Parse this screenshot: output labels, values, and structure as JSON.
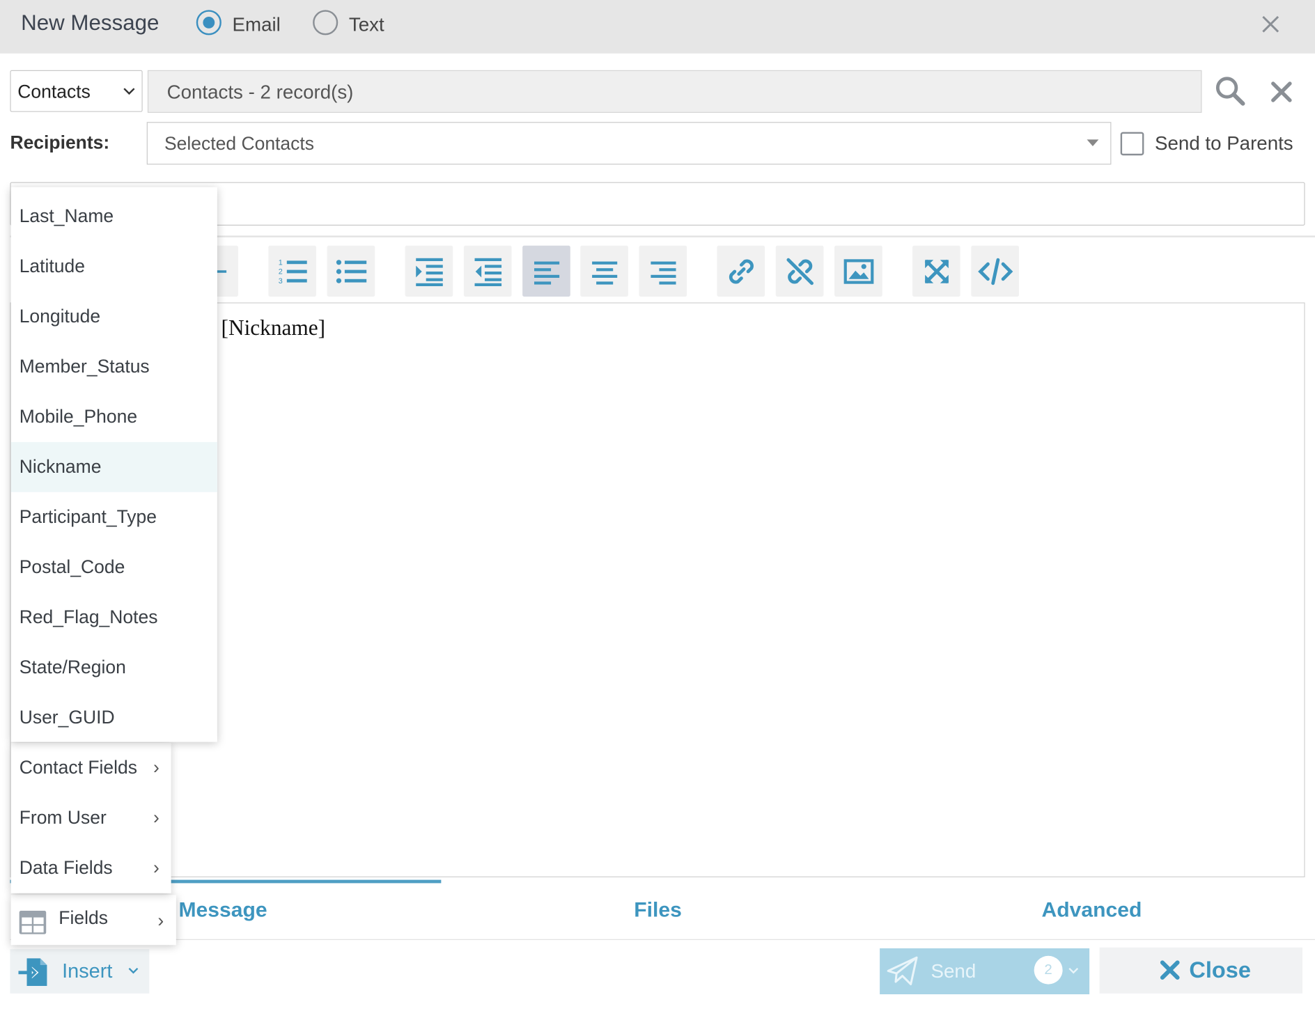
{
  "header": {
    "title": "New Message",
    "mode_options": [
      {
        "label": "Email",
        "selected": true
      },
      {
        "label": "Text",
        "selected": false
      }
    ]
  },
  "source": {
    "type_value": "Contacts",
    "records_value": "Contacts - 2 record(s)"
  },
  "recipients": {
    "label": "Recipients:",
    "value": "Selected Contacts",
    "send_to_parents_label": "Send to Parents",
    "send_to_parents_checked": false
  },
  "editor": {
    "visible_text": "t [Nickname]"
  },
  "toolbar": {
    "buttons": [
      "strikethrough",
      "ordered-list",
      "unordered-list",
      "indent",
      "outdent",
      "align-left",
      "align-center",
      "align-right",
      "link",
      "unlink",
      "image",
      "fullscreen",
      "code-view"
    ],
    "active": "align-left"
  },
  "field_menu": {
    "items": [
      "Last_Name",
      "Latitude",
      "Longitude",
      "Member_Status",
      "Mobile_Phone",
      "Nickname",
      "Participant_Type",
      "Postal_Code",
      "Red_Flag_Notes",
      "State/Region",
      "User_GUID"
    ],
    "highlighted": "Nickname"
  },
  "insert_menu": {
    "groups": [
      "Contact Fields",
      "From User",
      "Data Fields"
    ],
    "fields_label": "Fields"
  },
  "tabs": {
    "message": "Message",
    "files": "Files",
    "advanced": "Advanced",
    "active": "Message"
  },
  "actions": {
    "insert_label": "Insert",
    "send_label": "Send",
    "send_count": "2",
    "close_label": "Close"
  },
  "colors": {
    "accent": "#3d95bf",
    "header_bg": "#e6e6e6",
    "send_bg": "#a9d4e6"
  }
}
